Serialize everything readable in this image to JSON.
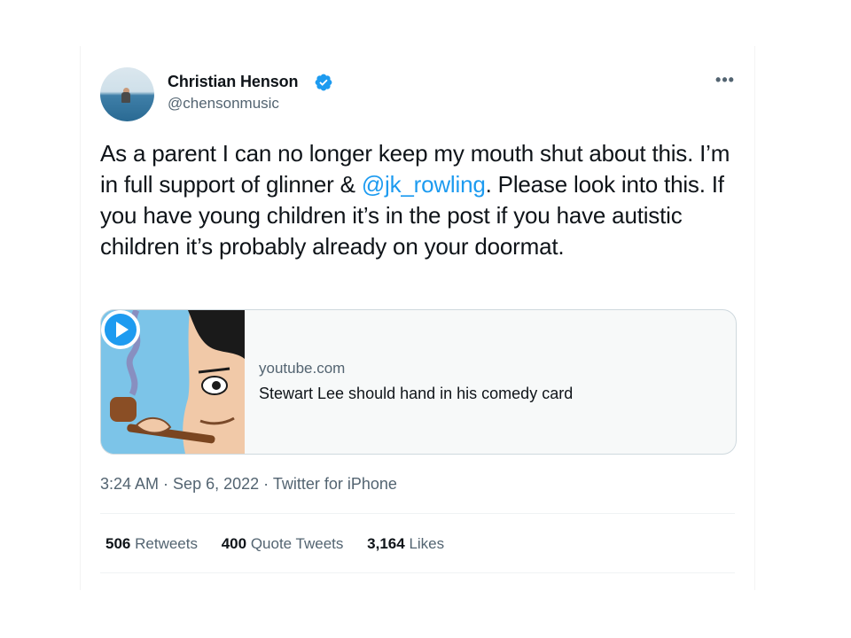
{
  "author": {
    "name": "Christian Henson",
    "handle": "@chensonmusic",
    "verified": true,
    "avatar_icon": "avatar-sea-photo"
  },
  "tweet": {
    "text_before_mention": "As a parent I can no longer keep my mouth shut about this. I’m in full support of glinner & ",
    "mention": "@jk_rowling",
    "text_after_mention": ". Please look into this. If you have young children it’s in the post if you have autistic children it’s probably already on your doormat."
  },
  "link_card": {
    "domain": "youtube.com",
    "title": "Stewart Lee should hand in his comedy card",
    "thumbnail_icon": "cartoon-man-pipe-thumbnail",
    "play_icon": "play-icon"
  },
  "meta": {
    "time": "3:24 AM",
    "date": "Sep 6, 2022",
    "source": "Twitter for iPhone",
    "separator": " · "
  },
  "stats": {
    "retweets_count": "506",
    "retweets_label": "Retweets",
    "quotes_count": "400",
    "quotes_label": "Quote Tweets",
    "likes_count": "3,164",
    "likes_label": "Likes"
  },
  "colors": {
    "accent": "#1d9bf0",
    "secondary_text": "#536471",
    "primary_text": "#0f1419",
    "border": "#cfd9de"
  }
}
